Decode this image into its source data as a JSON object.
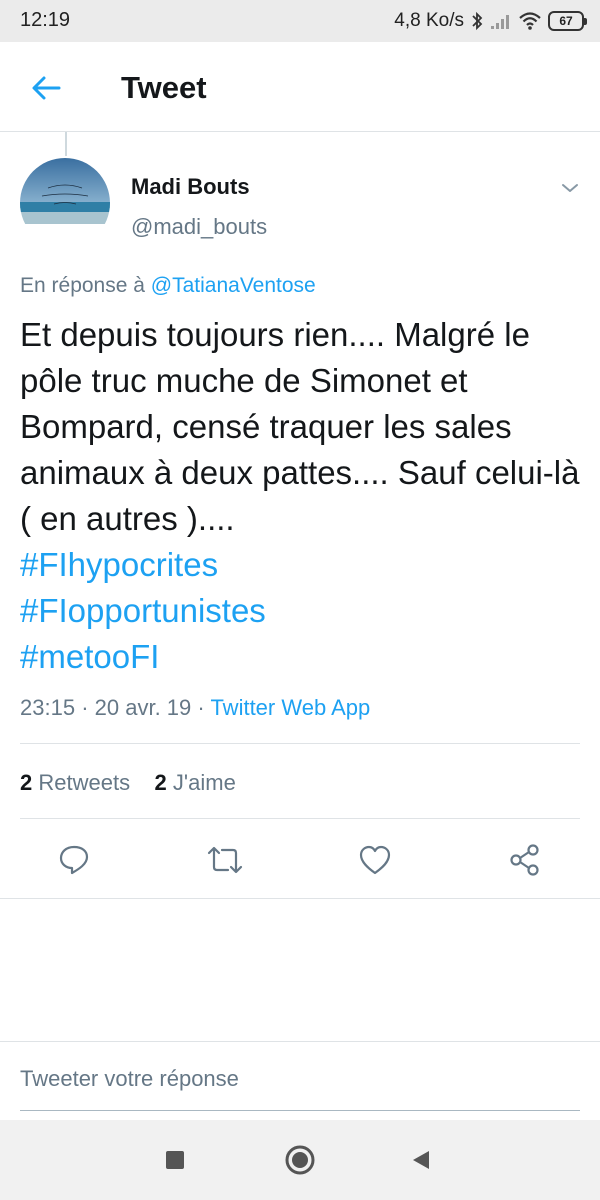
{
  "status_bar": {
    "time": "12:19",
    "network_speed": "4,8 Ko/s",
    "battery": "67"
  },
  "header": {
    "title": "Tweet"
  },
  "tweet": {
    "author_name": "Madi Bouts",
    "author_handle": "@madi_bouts",
    "reply_prefix": "En réponse à",
    "reply_to": "@TatianaVentose",
    "text": "Et depuis toujours rien.... Malgré le pôle truc muche de Simonet et Bompard, censé traquer les sales animaux à deux pattes.... Sauf celui-là ( en autres )....",
    "hashtags": [
      "#FIhypocrites",
      "#FIopportunistes",
      "#metooFI"
    ],
    "time": "23:15",
    "date": "20 avr. 19",
    "separator": "·",
    "source": "Twitter Web App",
    "retweets_count": "2",
    "retweets_label": "Retweets",
    "likes_count": "2",
    "likes_label": "J'aime"
  },
  "actions": {
    "reply": "reply-icon",
    "retweet": "retweet-icon",
    "like": "heart-icon",
    "share": "share-icon"
  },
  "reply_box": {
    "placeholder": "Tweeter votre réponse"
  },
  "colors": {
    "accent": "#1da1f2",
    "secondary_text": "#657786",
    "primary_text": "#14171a"
  }
}
